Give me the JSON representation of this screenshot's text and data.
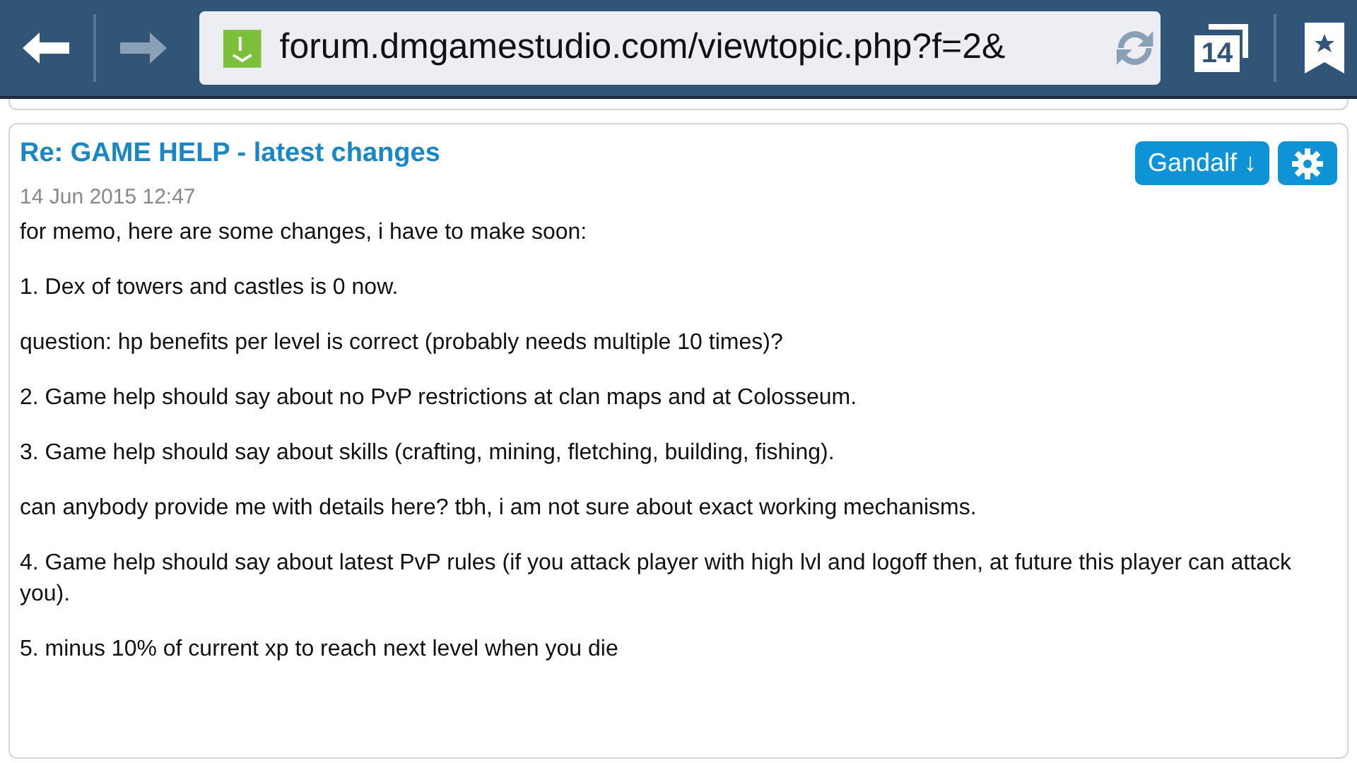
{
  "toolbar": {
    "url": "forum.dmgamestudio.com/viewtopic.php?f=2&",
    "tab_count": "14",
    "back_enabled": true,
    "forward_enabled": false
  },
  "post": {
    "title": "Re: GAME HELP - latest changes",
    "date": "14 Jun 2015 12:47",
    "author_button": "Gandalf ↓",
    "paragraphs": [
      "for memo, here are some changes, i have to make soon:",
      "1. Dex of towers and castles is 0 now.",
      "question: hp benefits per level is correct (probably needs multiple 10 times)?",
      "2. Game help should say about no PvP restrictions at clan maps and at Colosseum.",
      "3. Game help should say about skills (crafting, mining, fletching, building, fishing).",
      "can anybody provide me with details here? tbh, i am not sure about exact working mechanisms.",
      "4. Game help should say about latest PvP rules (if you attack player with high lvl and logoff then, at future this player can attack you).",
      "5. minus 10% of current xp to reach next level when you die"
    ]
  }
}
